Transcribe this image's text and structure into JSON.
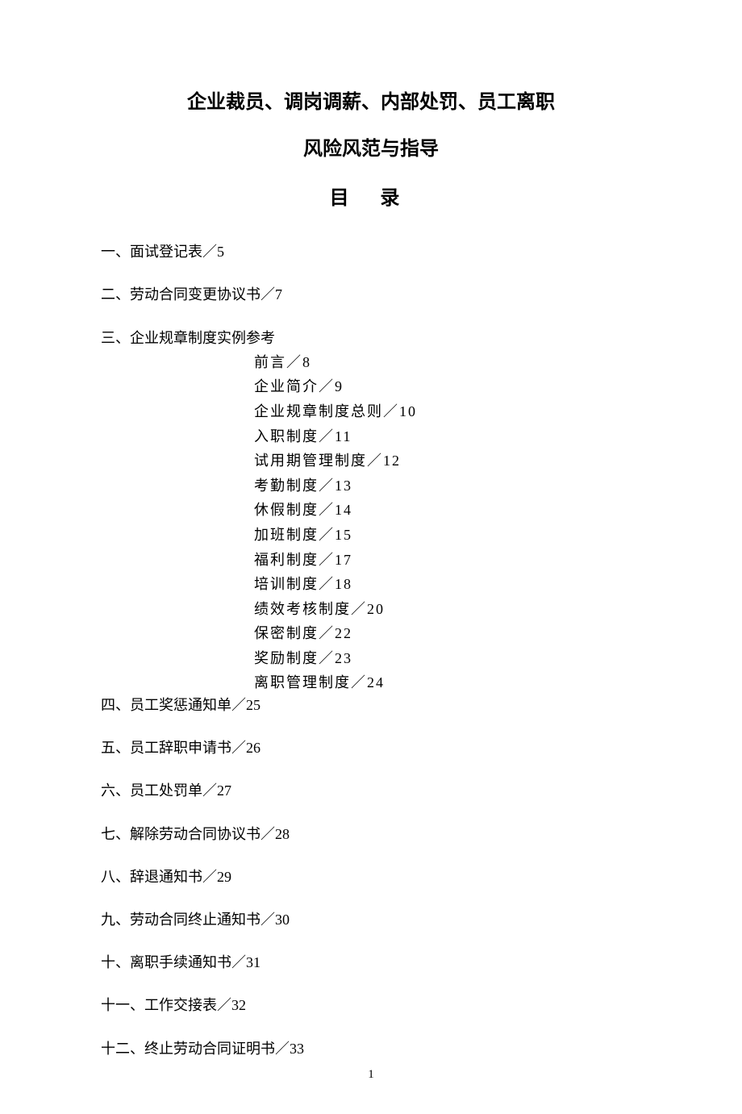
{
  "title": {
    "line1": "企业裁员、调岗调薪、内部处罚、员工离职",
    "line2": "风险风范与指导"
  },
  "tocHeading": "目 录",
  "toc": [
    {
      "label": "一、面试登记表／5"
    },
    {
      "label": "二、劳动合同变更协议书／7"
    },
    {
      "label": "三、企业规章制度实例参考",
      "sub": [
        "前言／8",
        "企业简介／9",
        "企业规章制度总则／10",
        "入职制度／11",
        "试用期管理制度／12",
        "考勤制度／13",
        "休假制度／14",
        "加班制度／15",
        "福利制度／17",
        "培训制度／18",
        "绩效考核制度／20",
        "保密制度／22",
        "奖励制度／23",
        "离职管理制度／24"
      ]
    },
    {
      "label": "四、员工奖惩通知单／25"
    },
    {
      "label": "五、员工辞职申请书／26"
    },
    {
      "label": "六、员工处罚单／27"
    },
    {
      "label": "七、解除劳动合同协议书／28"
    },
    {
      "label": "八、辞退通知书／29"
    },
    {
      "label": "九、劳动合同终止通知书／30"
    },
    {
      "label": "十、离职手续通知书／31"
    },
    {
      "label": "十一、工作交接表／32"
    },
    {
      "label": "十二、终止劳动合同证明书／33"
    }
  ],
  "pageNumber": "1"
}
